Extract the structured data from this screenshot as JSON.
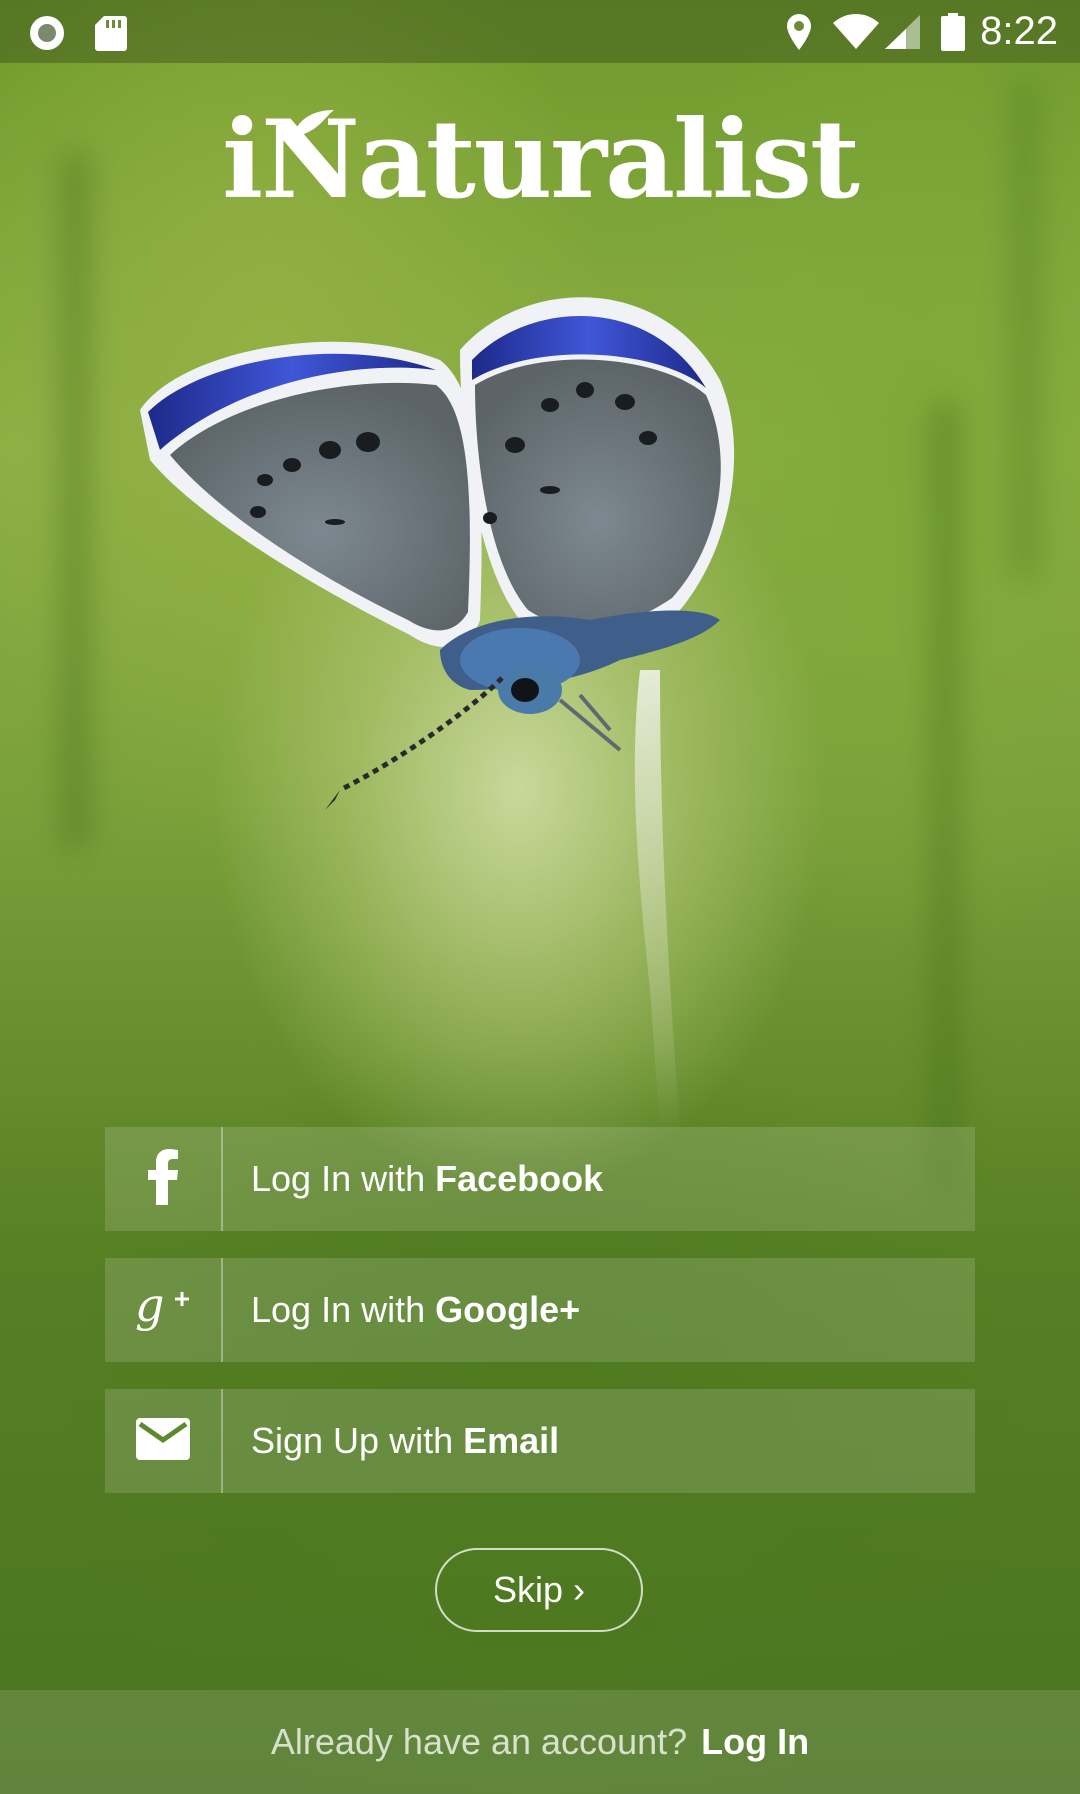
{
  "status_bar": {
    "time": "8:22",
    "icons": [
      "record-icon",
      "sd-card-icon",
      "location-icon",
      "wifi-icon",
      "cell-signal-icon",
      "battery-icon"
    ]
  },
  "app": {
    "logo_text": "iNaturalist"
  },
  "login_options": [
    {
      "icon": "facebook-icon",
      "prefix": "Log In with ",
      "provider": "Facebook"
    },
    {
      "icon": "google-plus-icon",
      "prefix": "Log In with ",
      "provider": "Google+"
    },
    {
      "icon": "mail-icon",
      "prefix": "Sign Up with ",
      "provider": "Email"
    }
  ],
  "skip": {
    "label": "Skip ›"
  },
  "footer": {
    "prompt": "Already have an account?",
    "login_label": "Log In"
  }
}
